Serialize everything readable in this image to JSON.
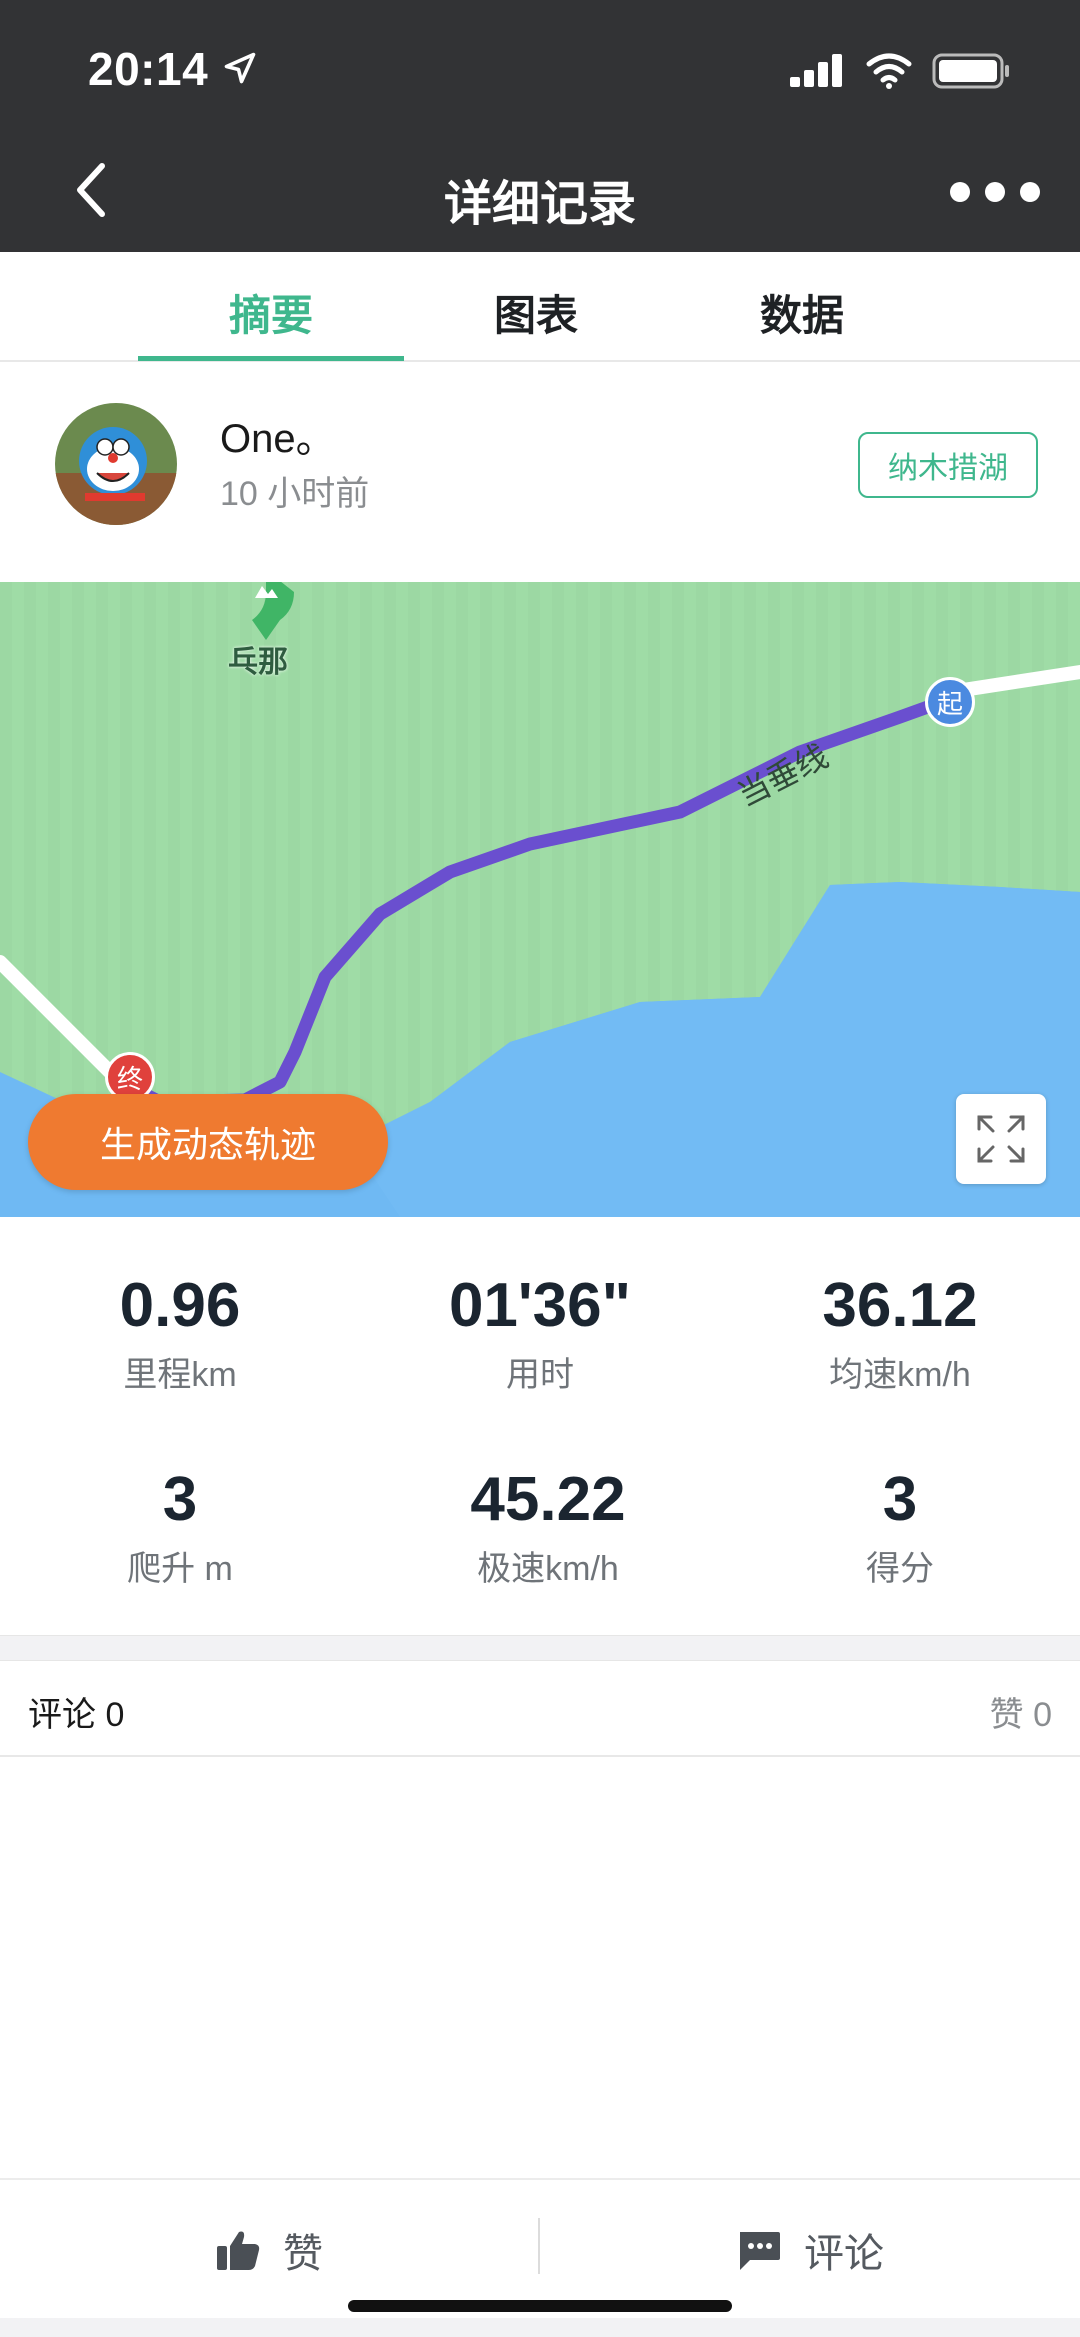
{
  "status_bar": {
    "time": "20:14"
  },
  "nav": {
    "title": "详细记录"
  },
  "tabs": [
    {
      "label": "摘要",
      "active": true
    },
    {
      "label": "图表",
      "active": false
    },
    {
      "label": "数据",
      "active": false
    }
  ],
  "user": {
    "name": "One。",
    "time_ago": "10 小时前",
    "location_tag": "纳木措湖"
  },
  "map": {
    "poi_label": "乓那",
    "road_label": "当垂线",
    "start_marker": "起",
    "end_marker": "终",
    "generate_button": "生成动态轨迹"
  },
  "stats": [
    {
      "value": "0.96",
      "label": "里程km"
    },
    {
      "value": "01'36\"",
      "label": "用时"
    },
    {
      "value": "36.12",
      "label": "均速km/h"
    },
    {
      "value": "3",
      "label": "爬升 m"
    },
    {
      "value": "45.22",
      "label": "极速km/h"
    },
    {
      "value": "3",
      "label": "得分"
    }
  ],
  "social": {
    "comments": "评论 0",
    "likes": "赞 0"
  },
  "bottom_bar": {
    "like_label": "赞",
    "comment_label": "评论"
  },
  "colors": {
    "accent": "#3fb78d",
    "orange": "#ef7a30",
    "route": "#6a4fcf",
    "water": "#6fb9f3",
    "land": "#9fdca6",
    "header": "#323335"
  }
}
